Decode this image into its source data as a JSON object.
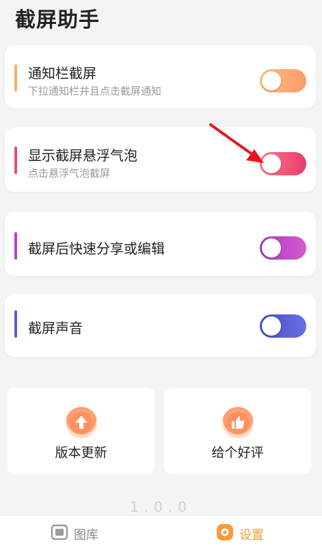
{
  "app": {
    "title": "截屏助手",
    "version": "1.0.0"
  },
  "settings": [
    {
      "title": "通知栏截屏",
      "subtitle": "下拉通知栏并且点击截屏通知",
      "accent": "#f6b06a"
    },
    {
      "title": "显示截屏悬浮气泡",
      "subtitle": "点击悬浮气泡截屏",
      "accent": "#e94d6e"
    },
    {
      "title": "截屏后快速分享或编辑",
      "subtitle": "",
      "accent": "#b046c6"
    },
    {
      "title": "截屏声音",
      "subtitle": "",
      "accent": "#5a5fcf"
    }
  ],
  "actions": [
    {
      "label": "版本更新",
      "icon": "upload-arrow-icon"
    },
    {
      "label": "给个好评",
      "icon": "thumbs-up-icon"
    }
  ],
  "nav": [
    {
      "label": "图库",
      "icon": "gallery-icon",
      "active": false
    },
    {
      "label": "设置",
      "icon": "settings-icon",
      "active": true
    }
  ],
  "colors": {
    "toggle_orange": [
      "#ffbf7a",
      "#ff9a6a"
    ],
    "toggle_pink": [
      "#ff7a8a",
      "#e93c6c"
    ],
    "toggle_purple": [
      "#a83bbf",
      "#d65cd0"
    ],
    "toggle_blue": [
      "#4a4fc9",
      "#6a6ee0"
    ],
    "nav_active": "#f79b3a",
    "nav_inactive": "#9a9a9a"
  }
}
